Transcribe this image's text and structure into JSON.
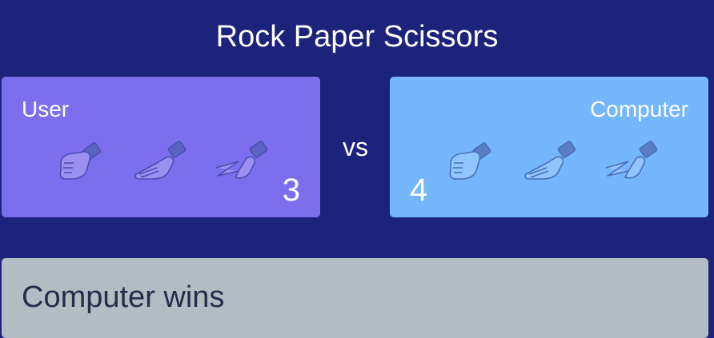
{
  "title": "Rock Paper Scissors",
  "vs_label": "vs",
  "user": {
    "name": "User",
    "score": "3",
    "choices": [
      "rock",
      "paper",
      "scissors"
    ]
  },
  "computer": {
    "name": "Computer",
    "score": "4",
    "choices": [
      "rock",
      "paper",
      "scissors"
    ]
  },
  "result": "Computer wins",
  "colors": {
    "background": "#1b237a",
    "user_panel": "#7c6fee",
    "computer_panel": "#74b7fd",
    "result_panel": "#b1bcc3",
    "hand_fill_user": "#9b8ff2",
    "hand_fill_computer": "#8fc6fd",
    "hand_stroke": "#4a4fb0"
  },
  "icons": {
    "rock": "fist-icon",
    "paper": "open-hand-icon",
    "scissors": "scissors-hand-icon"
  }
}
